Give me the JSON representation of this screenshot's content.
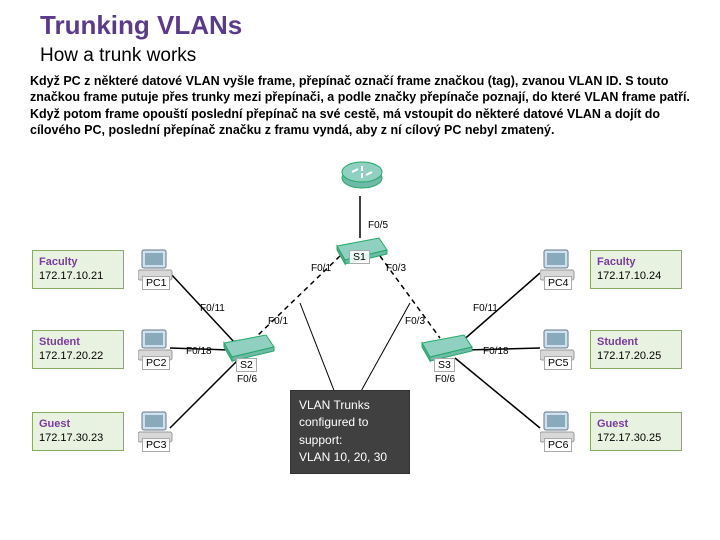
{
  "title": "Trunking VLANs",
  "subtitle": "How a trunk works",
  "paragraph": "Když PC z některé datové VLAN vyšle frame, přepínač označí frame značkou (tag), zvanou VLAN ID. S touto značkou frame putuje přes trunky mezi přepínači, a podle značky přepínače poznají, do které VLAN frame patří. Když potom frame opouští poslední přepínač na své cestě, má vstoupit do některé datové VLAN a dojít do cílového PC, poslední přepínač značku z framu vyndá, aby z ní cílový PC nebyl zmatený.",
  "devices": {
    "router": "",
    "s1": "S1",
    "s2": "S2",
    "s3": "S3",
    "pc1": "PC1",
    "pc2": "PC2",
    "pc3": "PC3",
    "pc4": "PC4",
    "pc5": "PC5",
    "pc6": "PC6"
  },
  "ports": {
    "s1_up": "F0/5",
    "s1_left": "F0/1",
    "s1_right": "F0/3",
    "s2_uplink": "F0/1",
    "s2_p11": "F0/11",
    "s2_p18": "F0/18",
    "s2_p6": "F0/6",
    "s3_uplink": "F0/3",
    "s3_p11": "F0/11",
    "s3_p18": "F0/18",
    "s3_p6": "F0/6"
  },
  "hosts": {
    "pc1": {
      "role": "Faculty",
      "ip": "172.17.10.21"
    },
    "pc2": {
      "role": "Student",
      "ip": "172.17.20.22"
    },
    "pc3": {
      "role": "Guest",
      "ip": "172.17.30.23"
    },
    "pc4": {
      "role": "Faculty",
      "ip": "172.17.10.24"
    },
    "pc5": {
      "role": "Student",
      "ip": "172.17.20.25"
    },
    "pc6": {
      "role": "Guest",
      "ip": "172.17.30.25"
    }
  },
  "callout": {
    "l1": "VLAN Trunks",
    "l2": "configured to",
    "l3": "support:",
    "l4": "VLAN 10, 20, 30"
  }
}
